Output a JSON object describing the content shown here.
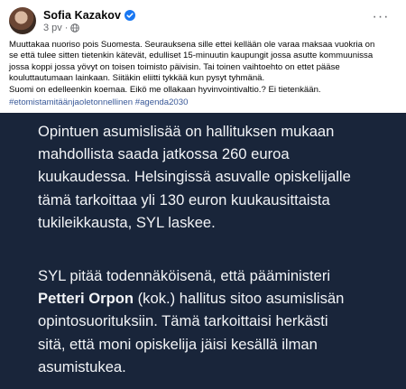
{
  "author": {
    "name": "Sofia Kazakov",
    "time": "3 pv",
    "separator": "·",
    "verified_icon": "verified-badge-icon",
    "audience_icon": "globe-icon",
    "more_icon": "more-options-icon",
    "more_label": "···"
  },
  "post": {
    "lines": [
      "Muuttakaa nuoriso pois Suomesta. Seurauksena sille ettei kellään ole varaa maksaa vuokria on",
      "se että tulee sitten tietenkin kätevät, edulliset 15-minuutin kaupungit jossa asutte kommuunissa",
      "jossa koppi jossa yövyt on toisen toimisto päivisin. Tai toinen vaihtoehto on ettet pääse",
      "kouluttautumaan lainkaan. Siitäkin eliitti tykkää kun pysyt tyhmänä.",
      "Suomi on edelleenkin koemaa. Eikö me ollakaan hyvinvointivaltio.? Ei tietenkään."
    ],
    "hashtags": [
      "#etomistamitäänjaoletonnellinen",
      "#agenda2030"
    ]
  },
  "image": {
    "background_color": "#19253a",
    "text_color": "#f2f4f7",
    "paragraph1": [
      "Opintuen asumislisää on hallituksen mukaan",
      "mahdollista saada jatkossa 260 euroa",
      "kuukaudessa. Helsingissä asuvalle opiskelijalle",
      "tämä tarkoittaa yli 130 euron kuukausittaista",
      "tukileikkausta, SYL laskee."
    ],
    "paragraph2": {
      "line1": "SYL pitää todennäköisenä, että pääministeri",
      "line2_bold": "Petteri Orpon",
      "line2_rest": " (kok.) hallitus sitoo asumislisän",
      "line3": "opintosuorituksiin. Tämä tarkoittaisi herkästi",
      "line4": "sitä, että moni opiskelija jäisi kesällä ilman",
      "line5": "asumistukea."
    }
  }
}
